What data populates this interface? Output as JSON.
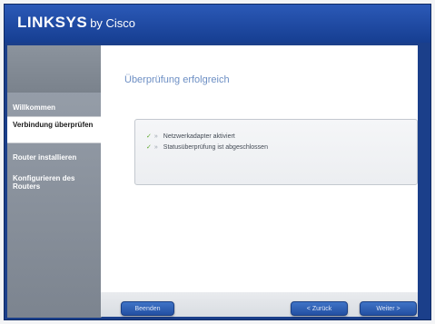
{
  "header": {
    "brand": "LINKSYS",
    "brand_suffix": "by Cisco"
  },
  "sidebar": {
    "items": [
      {
        "label": "Willkommen",
        "active": false
      },
      {
        "label": "Verbindung überprüfen",
        "active": true
      },
      {
        "label": "Router installieren",
        "active": false
      },
      {
        "label": "Konfigurieren des Routers",
        "active": false
      }
    ]
  },
  "main": {
    "title": "Überprüfung erfolgreich",
    "checks": [
      {
        "label": "Netzwerkadapter aktiviert",
        "icon": "checkmark-icon"
      },
      {
        "label": "Statusüberprüfung ist abgeschlossen",
        "icon": "checkmark-icon"
      }
    ]
  },
  "buttons": {
    "left": "Beenden",
    "back": "< Zurück",
    "next": "Weiter >"
  },
  "colors": {
    "header": "#1b3f8a",
    "button": "#2f62b8",
    "check": "#5fa82e",
    "title": "#6d8fc4"
  }
}
